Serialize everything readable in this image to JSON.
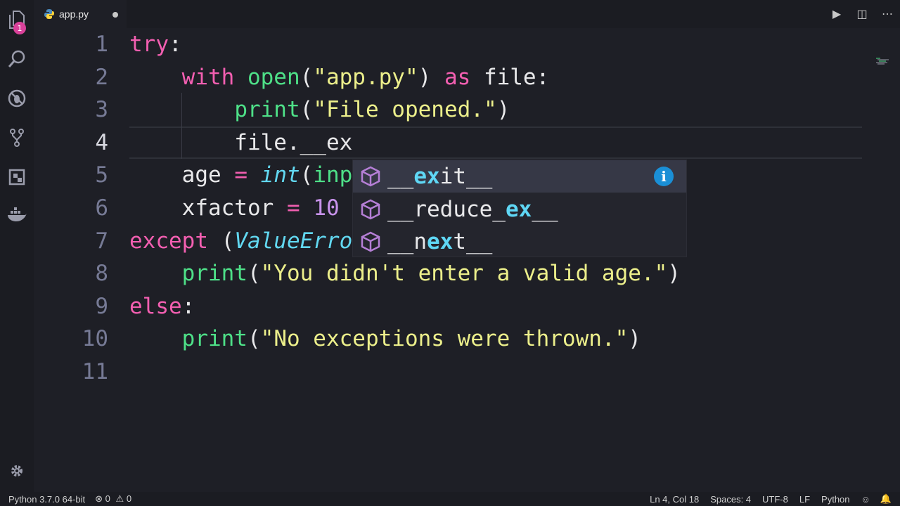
{
  "tab": {
    "filename": "app.py",
    "modified": true
  },
  "explorer_badge": "1",
  "activity_icons": [
    "files-icon",
    "search-icon",
    "debug-icon",
    "source-control-icon",
    "extensions-icon",
    "docker-icon",
    "gear-icon"
  ],
  "code_lines": [
    {
      "n": "1",
      "tokens": [
        [
          "kw",
          "try"
        ],
        [
          "p",
          ":"
        ]
      ]
    },
    {
      "n": "2",
      "tokens": [
        [
          "p",
          "    "
        ],
        [
          "kw",
          "with"
        ],
        [
          "p",
          " "
        ],
        [
          "fn",
          "open"
        ],
        [
          "p",
          "("
        ],
        [
          "str",
          "\"app.py\""
        ],
        [
          "p",
          ") "
        ],
        [
          "kw",
          "as"
        ],
        [
          "p",
          " file:"
        ]
      ]
    },
    {
      "n": "3",
      "tokens": [
        [
          "p",
          "        "
        ],
        [
          "fn",
          "print"
        ],
        [
          "p",
          "("
        ],
        [
          "str",
          "\"File opened.\""
        ],
        [
          "p",
          ")"
        ]
      ]
    },
    {
      "n": "4",
      "tokens": [
        [
          "p",
          "        file.__ex"
        ]
      ]
    },
    {
      "n": "5",
      "tokens": [
        [
          "p",
          "    age "
        ],
        [
          "kw",
          "="
        ],
        [
          "p",
          " "
        ],
        [
          "cls",
          "int"
        ],
        [
          "p",
          "("
        ],
        [
          "fn",
          "inp"
        ]
      ]
    },
    {
      "n": "6",
      "tokens": [
        [
          "p",
          "    xfactor "
        ],
        [
          "kw",
          "="
        ],
        [
          "p",
          " "
        ],
        [
          "num",
          "10"
        ]
      ]
    },
    {
      "n": "7",
      "tokens": [
        [
          "kw",
          "except"
        ],
        [
          "p",
          " ("
        ],
        [
          "cls",
          "ValueErro"
        ]
      ]
    },
    {
      "n": "8",
      "tokens": [
        [
          "p",
          "    "
        ],
        [
          "fn",
          "print"
        ],
        [
          "p",
          "("
        ],
        [
          "str",
          "\"You didn't enter a valid age.\""
        ],
        [
          "p",
          ")"
        ]
      ]
    },
    {
      "n": "9",
      "tokens": [
        [
          "kw",
          "else"
        ],
        [
          "p",
          ":"
        ]
      ]
    },
    {
      "n": "10",
      "tokens": [
        [
          "p",
          "    "
        ],
        [
          "fn",
          "print"
        ],
        [
          "p",
          "("
        ],
        [
          "str",
          "\"No exceptions were thrown.\""
        ],
        [
          "p",
          ")"
        ]
      ]
    },
    {
      "n": "11",
      "tokens": []
    }
  ],
  "suggestions": [
    {
      "parts": [
        [
          "n",
          "__"
        ],
        [
          "h",
          "ex"
        ],
        [
          "n",
          "it__"
        ]
      ],
      "selected": true
    },
    {
      "parts": [
        [
          "n",
          "__reduce_"
        ],
        [
          "h",
          "ex"
        ],
        [
          "n",
          "__"
        ]
      ],
      "selected": false
    },
    {
      "parts": [
        [
          "n",
          "__n"
        ],
        [
          "h",
          "ex"
        ],
        [
          "n",
          "t__"
        ]
      ],
      "selected": false
    }
  ],
  "status": {
    "interpreter": "Python 3.7.0 64-bit",
    "errors": "0",
    "warnings": "0",
    "position": "Ln 4, Col 18",
    "spaces": "Spaces: 4",
    "encoding": "UTF-8",
    "eol": "LF",
    "language": "Python"
  },
  "colors": {
    "keyword": "#f35fb1",
    "function": "#4ee088",
    "string": "#ecef8b",
    "number": "#c792ea",
    "class": "#62d8f1",
    "match": "#5fd7f5"
  }
}
